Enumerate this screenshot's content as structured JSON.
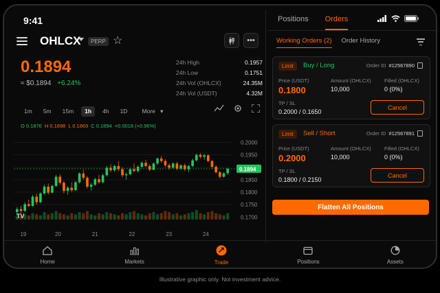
{
  "status": {
    "time": "9:41"
  },
  "header": {
    "symbol": "OHLCX",
    "type_badge": "PERP"
  },
  "ticker": {
    "price": "0.1894",
    "usd_price": "≈ $0.1894",
    "change": "+6.24%"
  },
  "stats": [
    {
      "label": "24h High",
      "value": "0.1957"
    },
    {
      "label": "24h Low",
      "value": "0.1751"
    },
    {
      "label": "24h Vol (OHLCX)",
      "value": "24.35M"
    },
    {
      "label": "24h Vol (USDT)",
      "value": "4.32M"
    }
  ],
  "timeframes": {
    "items": [
      "1m",
      "5m",
      "15m",
      "1h",
      "4h",
      "1D",
      "More"
    ],
    "active": "1h"
  },
  "ohlc": {
    "o": "O 0.1876",
    "h": "H 0.1898",
    "l": "L 0.1869",
    "c": "C 0.1894",
    "chg": "+0.0018 (+0.96%)"
  },
  "chart_data": {
    "type": "candlestick",
    "x_ticks": [
      "19",
      "20",
      "21",
      "22",
      "23",
      "24"
    ],
    "y_ticks": [
      "0.2000",
      "0.1950",
      "0.1900",
      "0.1850",
      "0.1800",
      "0.1750",
      "0.1700"
    ],
    "ylim": [
      0.169,
      0.2015
    ],
    "last_price_label": "0.1894",
    "last_price": 0.1894,
    "colors": {
      "up": "#22c55e",
      "down": "#ff6a00"
    },
    "candles": [
      [
        0.172,
        0.174,
        0.1705,
        0.1732
      ],
      [
        0.1732,
        0.1745,
        0.1715,
        0.1725
      ],
      [
        0.1725,
        0.176,
        0.172,
        0.1752
      ],
      [
        0.1752,
        0.177,
        0.174,
        0.1745
      ],
      [
        0.1745,
        0.179,
        0.1742,
        0.1782
      ],
      [
        0.1782,
        0.1795,
        0.175,
        0.176
      ],
      [
        0.176,
        0.18,
        0.1755,
        0.1795
      ],
      [
        0.1795,
        0.183,
        0.179,
        0.1822
      ],
      [
        0.1822,
        0.1835,
        0.179,
        0.1798
      ],
      [
        0.1798,
        0.183,
        0.1795,
        0.1825
      ],
      [
        0.1825,
        0.187,
        0.182,
        0.1862
      ],
      [
        0.1862,
        0.1872,
        0.183,
        0.1838
      ],
      [
        0.1838,
        0.1845,
        0.1795,
        0.1805
      ],
      [
        0.1805,
        0.1825,
        0.179,
        0.1818
      ],
      [
        0.1818,
        0.184,
        0.18,
        0.1808
      ],
      [
        0.1808,
        0.1845,
        0.1805,
        0.184
      ],
      [
        0.184,
        0.188,
        0.1835,
        0.1875
      ],
      [
        0.1875,
        0.189,
        0.185,
        0.1858
      ],
      [
        0.1858,
        0.1865,
        0.1815,
        0.1822
      ],
      [
        0.1822,
        0.1838,
        0.1805,
        0.183
      ],
      [
        0.183,
        0.1858,
        0.1825,
        0.1852
      ],
      [
        0.1852,
        0.187,
        0.1835,
        0.184
      ],
      [
        0.184,
        0.1875,
        0.1835,
        0.1868
      ],
      [
        0.1868,
        0.1905,
        0.1862,
        0.1898
      ],
      [
        0.1898,
        0.1912,
        0.188,
        0.1888
      ],
      [
        0.1888,
        0.191,
        0.1882,
        0.1905
      ],
      [
        0.1905,
        0.1925,
        0.1885,
        0.1892
      ],
      [
        0.1892,
        0.19,
        0.186,
        0.1868
      ],
      [
        0.1868,
        0.188,
        0.185,
        0.1872
      ],
      [
        0.1872,
        0.1898,
        0.1868,
        0.1892
      ],
      [
        0.1892,
        0.1915,
        0.188,
        0.1885
      ],
      [
        0.1885,
        0.1908,
        0.1878,
        0.1902
      ],
      [
        0.1902,
        0.1925,
        0.1895,
        0.1918
      ],
      [
        0.1918,
        0.193,
        0.19,
        0.1905
      ],
      [
        0.1905,
        0.1912,
        0.1885,
        0.189
      ],
      [
        0.189,
        0.192,
        0.1888,
        0.1915
      ],
      [
        0.1915,
        0.194,
        0.1908,
        0.1935
      ],
      [
        0.1935,
        0.1945,
        0.1918,
        0.1925
      ],
      [
        0.1925,
        0.1932,
        0.19,
        0.1908
      ],
      [
        0.1908,
        0.1915,
        0.189,
        0.1898
      ],
      [
        0.1898,
        0.192,
        0.1895,
        0.1915
      ],
      [
        0.1915,
        0.1922,
        0.1888,
        0.1895
      ],
      [
        0.1895,
        0.1912,
        0.189,
        0.1908
      ],
      [
        0.1908,
        0.1915,
        0.1885,
        0.1892
      ],
      [
        0.1892,
        0.191,
        0.188,
        0.1905
      ],
      [
        0.1905,
        0.1935,
        0.19,
        0.1928
      ],
      [
        0.1928,
        0.1955,
        0.1922,
        0.195
      ],
      [
        0.195,
        0.1957,
        0.1935,
        0.1942
      ],
      [
        0.1942,
        0.1955,
        0.193,
        0.1948
      ],
      [
        0.1948,
        0.1952,
        0.192,
        0.1925
      ],
      [
        0.1925,
        0.193,
        0.1895,
        0.1902
      ],
      [
        0.1902,
        0.1908,
        0.1875,
        0.188
      ],
      [
        0.188,
        0.1885,
        0.1855,
        0.1862
      ],
      [
        0.1862,
        0.188,
        0.1858,
        0.1876
      ],
      [
        0.1876,
        0.1898,
        0.1869,
        0.1894
      ]
    ],
    "volumes": [
      3,
      4,
      5,
      4,
      6,
      5,
      4,
      7,
      5,
      6,
      8,
      6,
      5,
      4,
      6,
      5,
      7,
      6,
      8,
      5,
      4,
      6,
      5,
      7,
      6,
      5,
      4,
      6,
      5,
      7,
      8,
      6,
      5,
      4,
      6,
      7,
      5,
      6,
      8,
      7,
      5,
      6,
      4,
      5,
      6,
      7,
      9,
      6,
      5,
      7,
      8,
      6,
      5,
      4,
      6
    ]
  },
  "right": {
    "tabs": [
      {
        "label": "Positions",
        "active": false
      },
      {
        "label": "Orders",
        "active": true
      }
    ],
    "subtabs": [
      {
        "label": "Working Orders (2)",
        "active": true
      },
      {
        "label": "Order History",
        "active": false
      }
    ],
    "orders": [
      {
        "type": "Limit",
        "side": "Buy / Long",
        "side_color": "#22c55e",
        "order_id_label": "Order ID",
        "order_id": "#12567890",
        "price_label": "Price (USDT)",
        "price": "0.1800",
        "amount_label": "Amount (OHLCX)",
        "amount": "10,000",
        "filled_label": "Filled (OHLCX)",
        "filled": "0 (0%)",
        "tpsl_label": "TP / SL",
        "tpsl": "0.2000 / 0.1650",
        "cancel": "Cancel"
      },
      {
        "type": "Limit",
        "side": "Sell / Short",
        "side_color": "#ff6a00",
        "order_id_label": "Order ID",
        "order_id": "#12567891",
        "price_label": "Price (USDT)",
        "price": "0.2000",
        "amount_label": "Amount (OHLCX)",
        "amount": "10,000",
        "filled_label": "Filled (OHLCX)",
        "filled": "0 (0%)",
        "tpsl_label": "TP / SL",
        "tpsl": "0.1800 / 0.2150",
        "cancel": "Cancel"
      }
    ],
    "flatten": "Flatten All Positions"
  },
  "nav": [
    {
      "label": "Home",
      "icon": "home-icon",
      "active": false
    },
    {
      "label": "Markets",
      "icon": "markets-icon",
      "active": false
    },
    {
      "label": "Trade",
      "icon": "trade-icon",
      "active": true
    },
    {
      "label": "Positions",
      "icon": "positions-icon",
      "active": false
    },
    {
      "label": "Assets",
      "icon": "assets-icon",
      "active": false
    }
  ],
  "disclaimer": "Illustrative graphic only. Not investment advice."
}
